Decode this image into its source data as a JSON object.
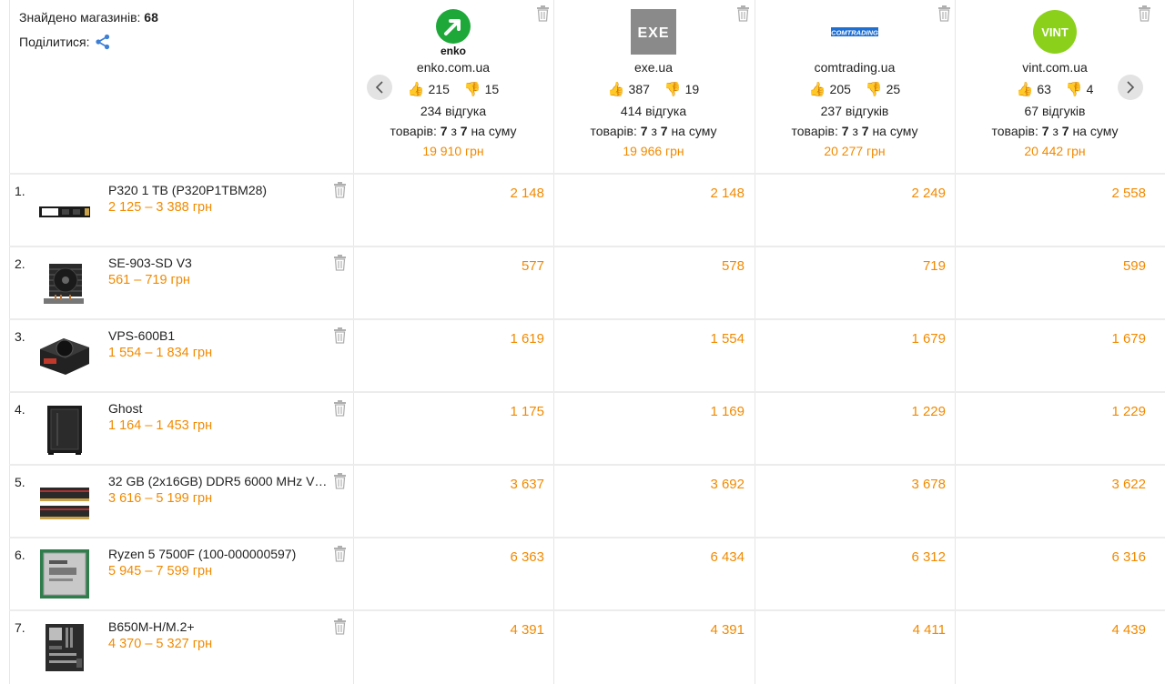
{
  "summary": {
    "found_label": "Знайдено магазинів:",
    "found_count": "68",
    "share_label": "Поділитися:"
  },
  "stores": [
    {
      "domain": "enko.com.ua",
      "logo_text": "enko",
      "likes": "215",
      "dislikes": "15",
      "reviews": "234 відгука",
      "goods_prefix": "товарів:",
      "goods_have": "7",
      "goods_of": "з",
      "goods_total": "7",
      "goods_suffix": "на суму",
      "total": "19 910 грн",
      "brand_color": "#1fa83a"
    },
    {
      "domain": "exe.ua",
      "logo_text": "EXE",
      "likes": "387",
      "dislikes": "19",
      "reviews": "414 відгука",
      "goods_prefix": "товарів:",
      "goods_have": "7",
      "goods_of": "з",
      "goods_total": "7",
      "goods_suffix": "на суму",
      "total": "19 966 грн",
      "brand_color": "#8a8a8a"
    },
    {
      "domain": "comtrading.ua",
      "logo_text": "COMTRADING",
      "likes": "205",
      "dislikes": "25",
      "reviews": "237 відгуків",
      "goods_prefix": "товарів:",
      "goods_have": "7",
      "goods_of": "з",
      "goods_total": "7",
      "goods_suffix": "на суму",
      "total": "20 277 грн",
      "brand_color": "#1f6fd0"
    },
    {
      "domain": "vint.com.ua",
      "logo_text": "VINT",
      "likes": "63",
      "dislikes": "4",
      "reviews": "67 відгуків",
      "goods_prefix": "товарів:",
      "goods_have": "7",
      "goods_of": "з",
      "goods_total": "7",
      "goods_suffix": "на суму",
      "total": "20 442 грн",
      "brand_color": "#8bd11c"
    }
  ],
  "products": [
    {
      "num": "1.",
      "name": "P320 1 TB (P320P1TBM28)",
      "range": "2 125 – 3 388 грн",
      "prices": [
        "2 148",
        "2 148",
        "2 249",
        "2 558"
      ],
      "icon": "ssd-icon"
    },
    {
      "num": "2.",
      "name": "SE-903-SD V3",
      "range": "561 – 719 грн",
      "prices": [
        "577",
        "578",
        "719",
        "599"
      ],
      "icon": "cooler-icon"
    },
    {
      "num": "3.",
      "name": "VPS-600B1",
      "range": "1 554 – 1 834 грн",
      "prices": [
        "1 619",
        "1 554",
        "1 679",
        "1 679"
      ],
      "icon": "psu-icon"
    },
    {
      "num": "4.",
      "name": "Ghost",
      "range": "1 164 – 1 453 грн",
      "prices": [
        "1 175",
        "1 169",
        "1 229",
        "1 229"
      ],
      "icon": "case-icon"
    },
    {
      "num": "5.",
      "name": "32 GB (2x16GB) DDR5 6000 MHz V…",
      "range": "3 616 – 5 199 грн",
      "prices": [
        "3 637",
        "3 692",
        "3 678",
        "3 622"
      ],
      "icon": "ram-icon"
    },
    {
      "num": "6.",
      "name": "Ryzen 5 7500F (100-000000597)",
      "range": "5 945 – 7 599 грн",
      "prices": [
        "6 363",
        "6 434",
        "6 312",
        "6 316"
      ],
      "icon": "cpu-icon"
    },
    {
      "num": "7.",
      "name": "B650M-H/M.2+",
      "range": "4 370 – 5 327 грн",
      "prices": [
        "4 391",
        "4 391",
        "4 411",
        "4 439"
      ],
      "icon": "motherboard-icon"
    }
  ],
  "colors": {
    "price": "#f18a00",
    "like": "#5aa832",
    "dislike": "#e05555",
    "share": "#3d7fd6"
  }
}
